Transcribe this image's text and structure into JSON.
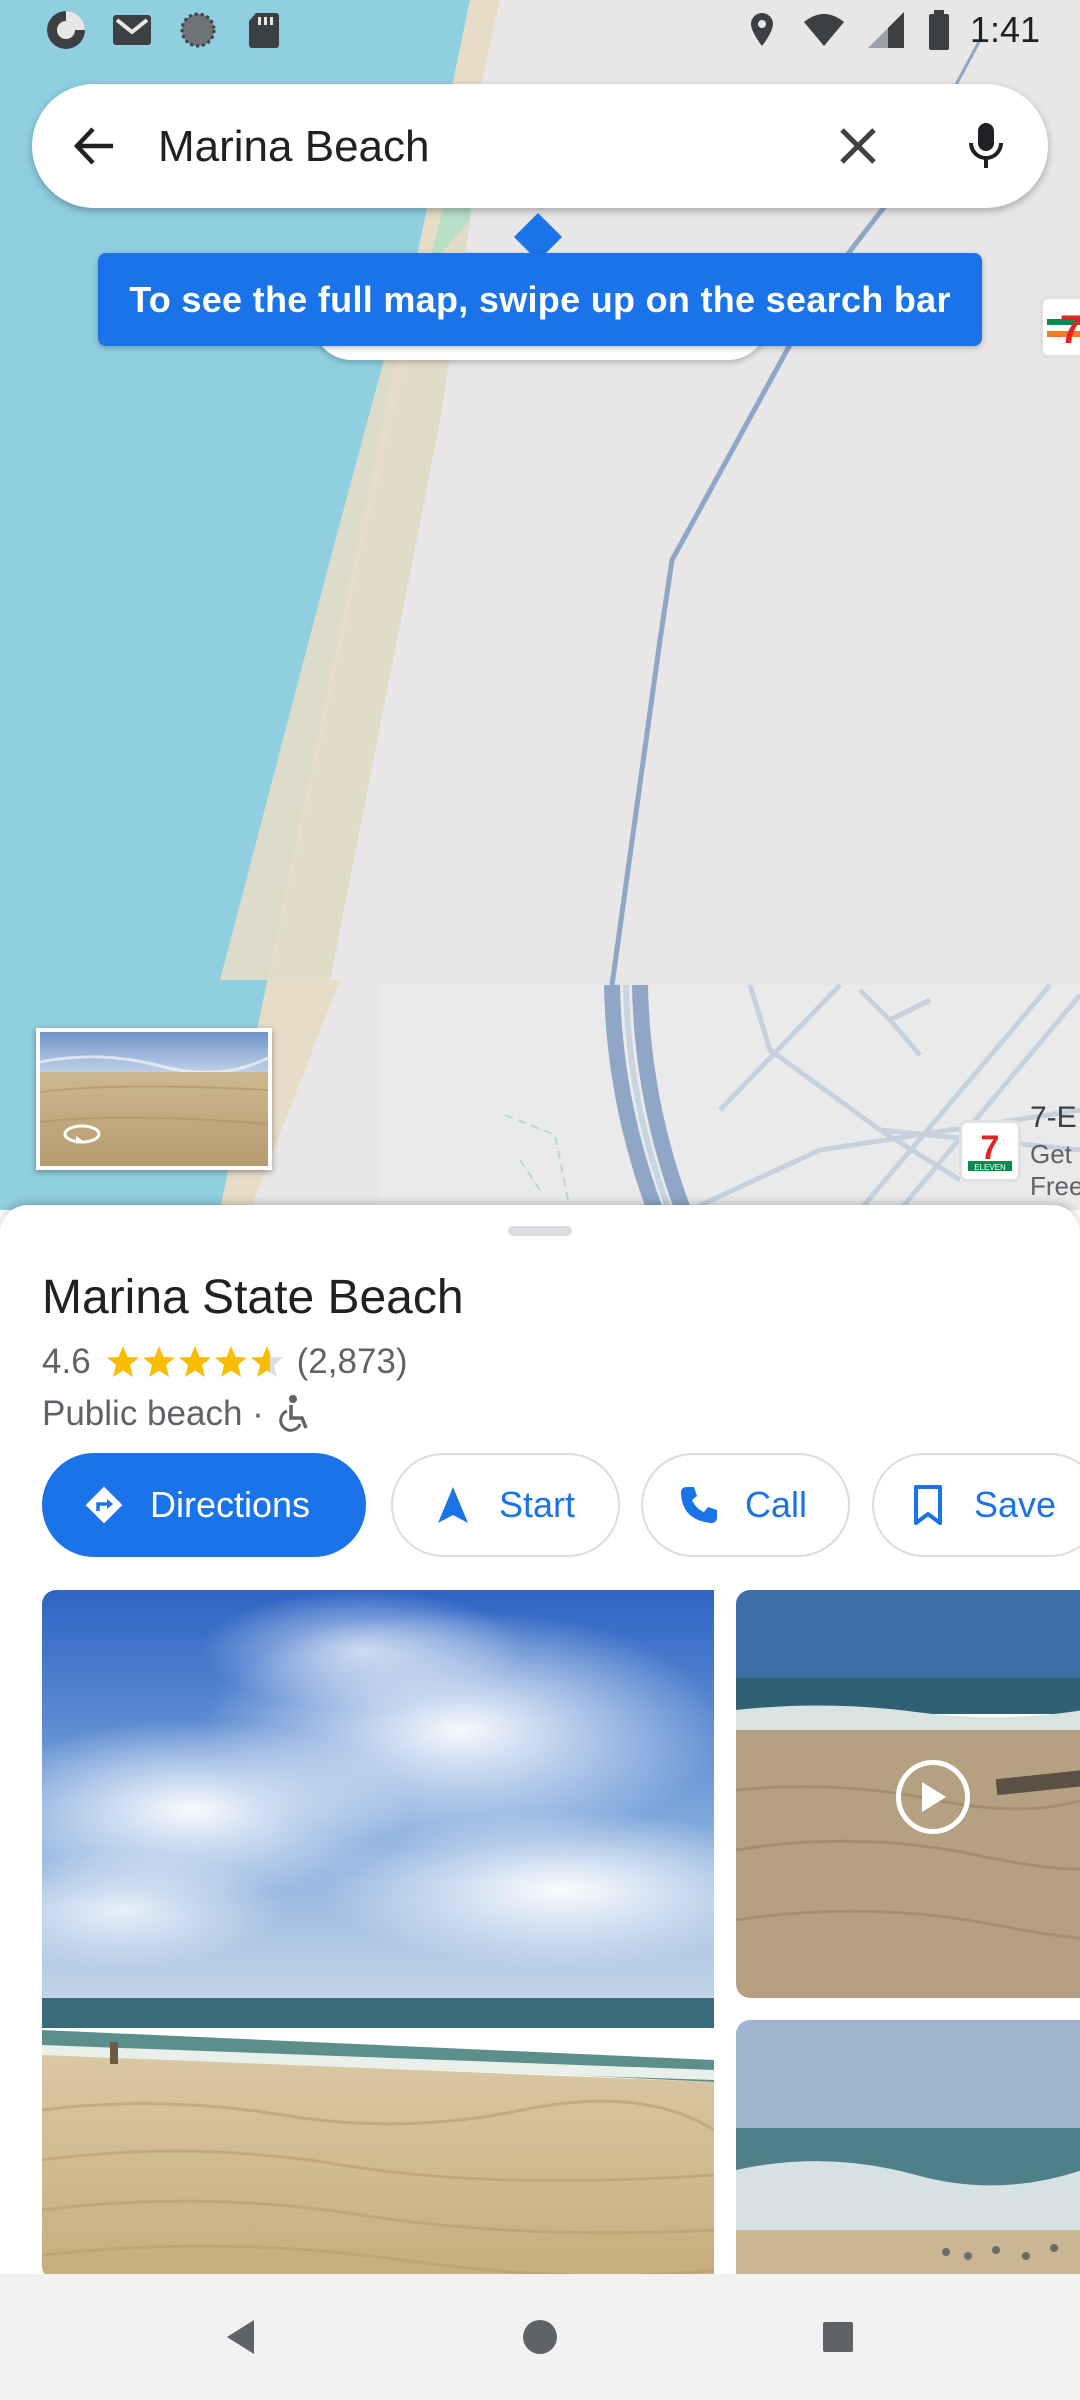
{
  "status_bar": {
    "time": "1:41",
    "left_icons": [
      "app-notification-icon",
      "gmail-icon",
      "settings-notification-icon",
      "sd-card-icon"
    ],
    "right_icons": [
      "location-icon",
      "wifi-icon",
      "signal-icon",
      "battery-icon"
    ]
  },
  "search": {
    "query": "Marina Beach",
    "back_icon": "arrow-back-icon",
    "clear_icon": "close-icon",
    "mic_icon": "mic-icon"
  },
  "tooltip": {
    "text": "To see the full map, swipe up on the search bar"
  },
  "map": {
    "poi_label": "7-E",
    "poi_sub_1": "Get",
    "poi_sub_2": "Free",
    "poi_icon": "7-eleven-icon",
    "poi_badge_text": "ELEVEN",
    "poi_badge_number": "7",
    "street_view_icon": "360-view-icon",
    "colors": {
      "water": "#8fcfe0",
      "sand": "#e6dcc7",
      "park": "#b7e0c7",
      "land": "#e8e6e6",
      "road": "#8fa6c7"
    }
  },
  "place": {
    "name": "Marina State Beach",
    "rating": "4.6",
    "rating_value": 4.6,
    "reviews": "(2,873)",
    "category": "Public beach ·",
    "accessibility_icon": "wheelchair-icon"
  },
  "actions": [
    {
      "label": "Directions",
      "icon": "directions-icon"
    },
    {
      "label": "Start",
      "icon": "navigation-arrow-icon"
    },
    {
      "label": "Call",
      "icon": "phone-icon"
    },
    {
      "label": "Save",
      "icon": "bookmark-icon"
    }
  ],
  "photos": {
    "video_icon": "play-icon"
  },
  "nav": {
    "back_icon": "nav-back-icon",
    "home_icon": "nav-home-icon",
    "recents_icon": "nav-recents-icon"
  },
  "accent_color": "#1a73e8"
}
